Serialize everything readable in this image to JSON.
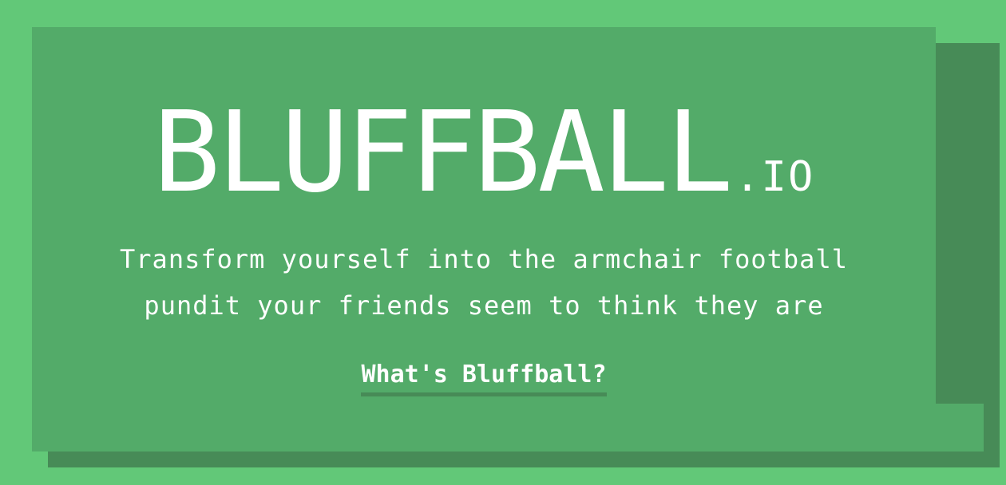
{
  "hero": {
    "logo_main": "BLUFFBALL",
    "logo_suffix": ".IO",
    "tagline_line1": "Transform yourself into the armchair football",
    "tagline_line2": "pundit your friends seem to think they are",
    "cta_label": "What's Bluffball?"
  },
  "colors": {
    "page_background": "#62c878",
    "card_background": "#53ab69",
    "card_shadow": "#478b57",
    "text": "#ffffff"
  }
}
